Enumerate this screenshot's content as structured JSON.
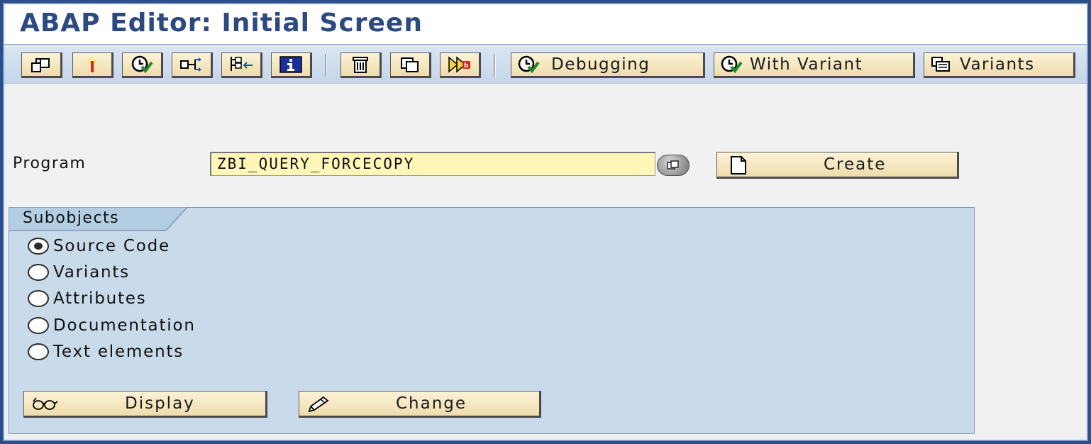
{
  "window": {
    "title": "ABAP Editor: Initial Screen"
  },
  "toolbar": {
    "icon_buttons_group1": [
      {
        "icon": "other-object-icon"
      },
      {
        "icon": "check-syntax-icon"
      },
      {
        "icon": "execute-icon"
      },
      {
        "icon": "where-used-icon"
      },
      {
        "icon": "object-list-icon"
      },
      {
        "icon": "info-icon"
      }
    ],
    "icon_buttons_group2": [
      {
        "icon": "delete-icon"
      },
      {
        "icon": "copy-icon"
      },
      {
        "icon": "rename-icon"
      }
    ],
    "debugging_label": "Debugging",
    "with_variant_label": "With Variant",
    "variants_label": "Variants"
  },
  "program": {
    "label": "Program",
    "value": "ZBI_QUERY_FORCECOPY",
    "create_label": "Create"
  },
  "subobjects": {
    "title": "Subobjects",
    "options": [
      {
        "label": "Source Code",
        "selected": true
      },
      {
        "label": "Variants",
        "selected": false
      },
      {
        "label": "Attributes",
        "selected": false
      },
      {
        "label": "Documentation",
        "selected": false
      },
      {
        "label": "Text elements",
        "selected": false
      }
    ],
    "display_label": "Display",
    "change_label": "Change"
  },
  "colors": {
    "title": "#2c4a80",
    "input_bg": "#fff6b8",
    "button_bg": "#efdcaa",
    "group_bg": "#c9dbeb"
  }
}
